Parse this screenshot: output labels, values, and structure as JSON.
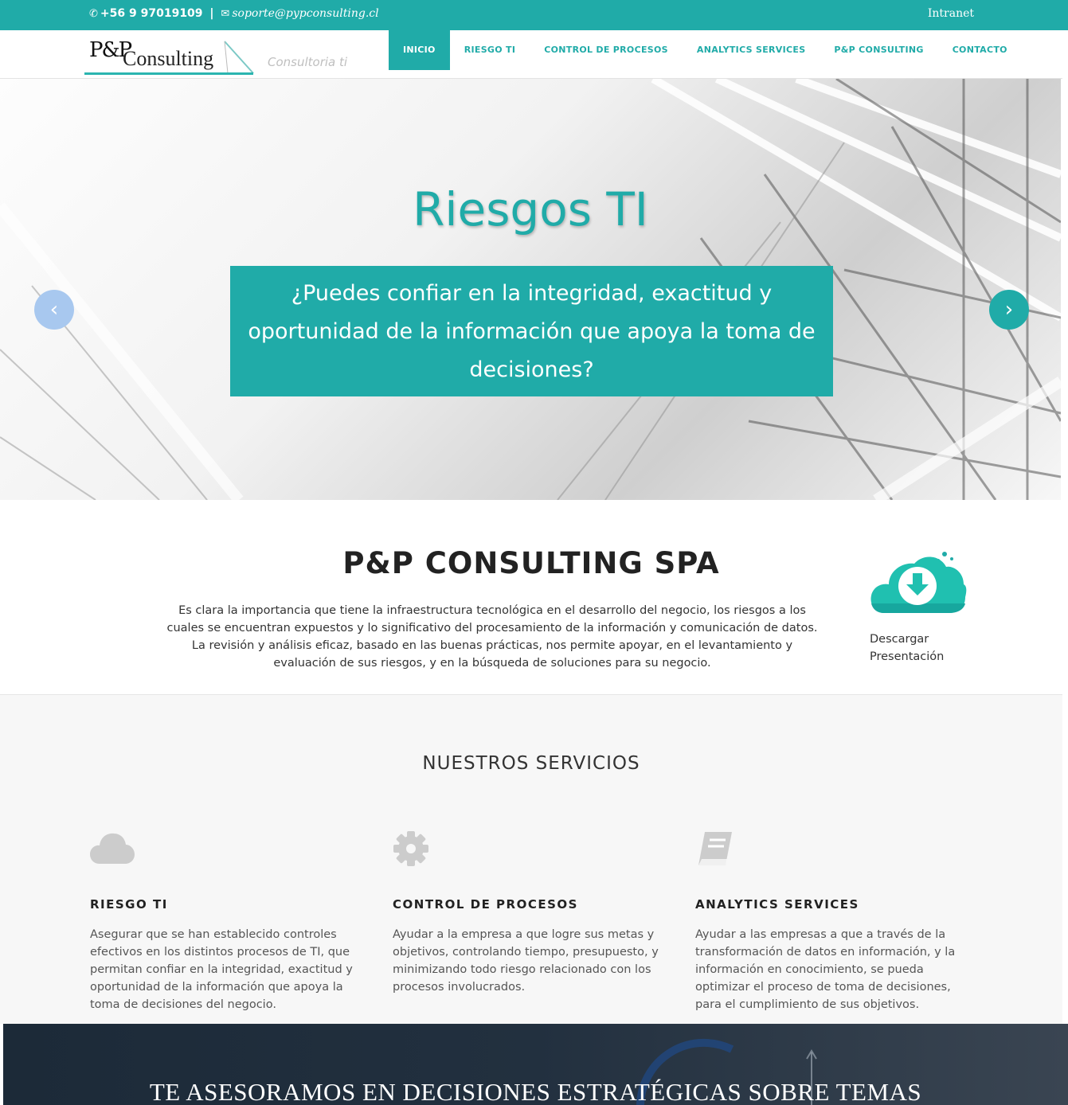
{
  "topbar": {
    "phone": "+56 9 97019109",
    "separator": "|",
    "email": "soporte@pypconsulting.cl",
    "intranet": "Intranet"
  },
  "header": {
    "logo_pp": "P&P",
    "logo_consulting": "Consulting",
    "tagline": "Consultoria ti",
    "nav": [
      {
        "label": "INICIO",
        "active": true
      },
      {
        "label": "RIESGO TI"
      },
      {
        "label": "CONTROL DE PROCESOS"
      },
      {
        "label": "ANALYTICS SERVICES"
      },
      {
        "label": "P&P CONSULTING"
      },
      {
        "label": "CONTACTO"
      }
    ]
  },
  "hero": {
    "title": "Riesgos TI",
    "caption": "¿Puedes confiar en la integridad, exactitud y oportunidad de la información que apoya la toma de decisiones?",
    "prev_icon": "chevron-left-icon",
    "next_icon": "chevron-right-icon"
  },
  "about": {
    "title": "P&P CONSULTING SPA",
    "description": "Es clara la importancia que tiene la infraestructura tecnológica en el desarrollo del negocio, los riesgos a los cuales se encuentran expuestos y lo significativo del procesamiento de la información y comunicación de datos. La revisión y análisis eficaz, basado en las buenas prácticas, nos permite apoyar, en el levantamiento y evaluación de sus riesgos, y en la búsqueda de soluciones para su negocio.",
    "download_label": "Descargar Presentación",
    "download_icon": "cloud-download-icon"
  },
  "services": {
    "title": "NUESTROS SERVICIOS",
    "items": [
      {
        "icon": "cloud-icon",
        "title": "RIESGO TI",
        "text": "Asegurar que se han establecido controles efectivos en los distintos procesos de TI, que permitan confiar en la integridad, exactitud y oportunidad de la información que apoya la toma de decisiones del negocio."
      },
      {
        "icon": "gear-icon",
        "title": "CONTROL DE PROCESOS",
        "text": "Ayudar a la empresa a que logre sus metas y objetivos, controlando tiempo, presupuesto, y minimizando todo riesgo relacionado con los procesos involucrados."
      },
      {
        "icon": "book-icon",
        "title": "ANALYTICS SERVICES",
        "text": "Ayudar a las empresas a que a través de la transformación de datos en información, y la información en conocimiento, se pueda optimizar el proceso de toma de decisiones, para el cumplimiento de sus objetivos."
      }
    ]
  },
  "banner": {
    "text": "TE ASESORAMOS EN DECISIONES ESTRATÉGICAS SOBRE TEMAS"
  },
  "colors": {
    "accent": "#20aba8",
    "arrow_prev": "#a8c8ef",
    "banner_bg": "#1c2a38"
  }
}
